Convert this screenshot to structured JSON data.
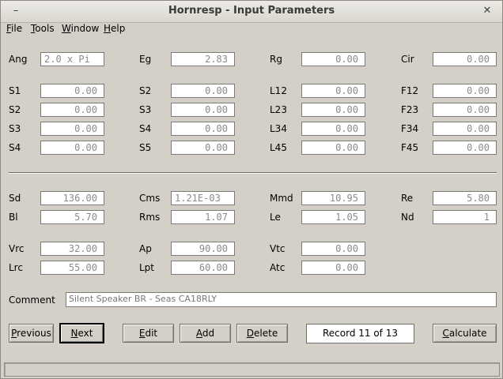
{
  "window": {
    "title": "Hornresp - Input Parameters",
    "min_glyph": "–",
    "close_glyph": "✕"
  },
  "menu": [
    {
      "accel": "F",
      "rest": "ile"
    },
    {
      "accel": "T",
      "rest": "ools"
    },
    {
      "accel": "W",
      "rest": "indow"
    },
    {
      "accel": "H",
      "rest": "elp"
    }
  ],
  "params": {
    "ang": {
      "label": "Ang",
      "value": "2.0 x Pi"
    },
    "eg": {
      "label": "Eg",
      "value": "2.83"
    },
    "rg": {
      "label": "Rg",
      "value": "0.00"
    },
    "cir": {
      "label": "Cir",
      "value": "0.00"
    },
    "s1a": {
      "label": "S1",
      "value": "0.00"
    },
    "s2a": {
      "label": "S2",
      "value": "0.00"
    },
    "s3a": {
      "label": "S3",
      "value": "0.00"
    },
    "s4a": {
      "label": "S4",
      "value": "0.00"
    },
    "s2b": {
      "label": "S2",
      "value": "0.00"
    },
    "s3b": {
      "label": "S3",
      "value": "0.00"
    },
    "s4b": {
      "label": "S4",
      "value": "0.00"
    },
    "s5b": {
      "label": "S5",
      "value": "0.00"
    },
    "l12": {
      "label": "L12",
      "value": "0.00"
    },
    "l23": {
      "label": "L23",
      "value": "0.00"
    },
    "l34": {
      "label": "L34",
      "value": "0.00"
    },
    "l45": {
      "label": "L45",
      "value": "0.00"
    },
    "f12": {
      "label": "F12",
      "value": "0.00"
    },
    "f23": {
      "label": "F23",
      "value": "0.00"
    },
    "f34": {
      "label": "F34",
      "value": "0.00"
    },
    "f45": {
      "label": "F45",
      "value": "0.00"
    },
    "sd": {
      "label": "Sd",
      "value": "136.00"
    },
    "bl": {
      "label": "Bl",
      "value": "5.70"
    },
    "cms": {
      "label": "Cms",
      "value": "1.21E-03"
    },
    "rms": {
      "label": "Rms",
      "value": "1.07"
    },
    "mmd": {
      "label": "Mmd",
      "value": "10.95"
    },
    "le": {
      "label": "Le",
      "value": "1.05"
    },
    "re": {
      "label": "Re",
      "value": "5.80"
    },
    "nd": {
      "label": "Nd",
      "value": "1"
    },
    "vrc": {
      "label": "Vrc",
      "value": "32.00"
    },
    "lrc": {
      "label": "Lrc",
      "value": "55.00"
    },
    "ap": {
      "label": "Ap",
      "value": "90.00"
    },
    "lpt": {
      "label": "Lpt",
      "value": "60.00"
    },
    "vtc": {
      "label": "Vtc",
      "value": "0.00"
    },
    "atc": {
      "label": "Atc",
      "value": "0.00"
    }
  },
  "comment": {
    "label": "Comment",
    "value": "Silent Speaker BR - Seas CA18RLY"
  },
  "buttons": {
    "previous": {
      "accel": "P",
      "rest": "revious"
    },
    "next": {
      "accel": "N",
      "rest": "ext"
    },
    "edit": {
      "accel": "E",
      "rest": "dit"
    },
    "add": {
      "accel": "A",
      "rest": "dd"
    },
    "delete": {
      "accel": "D",
      "rest": "elete"
    },
    "calculate": {
      "accel": "C",
      "rest": "alculate"
    }
  },
  "record": {
    "text": "Record 11 of 13"
  },
  "status": {
    "text": ""
  }
}
